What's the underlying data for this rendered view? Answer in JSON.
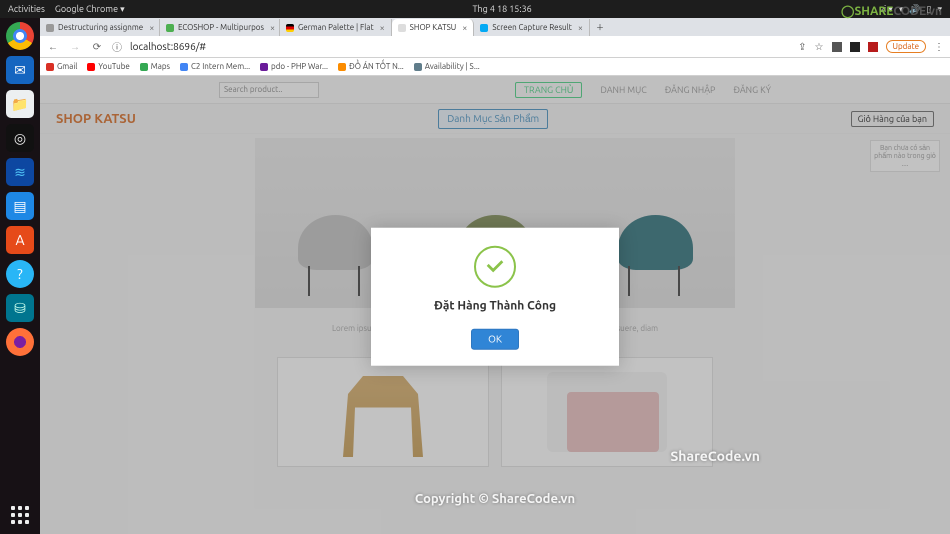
{
  "os": {
    "activities": "Activities",
    "app_name": "Google Chrome ▾",
    "clock": "Thg 4 18  15:36",
    "lang": "vi ▾",
    "tray_icons": [
      "network-icon",
      "volume-icon",
      "battery-icon",
      "power-icon"
    ]
  },
  "dock": [
    {
      "name": "chrome-icon"
    },
    {
      "name": "thunderbird-icon",
      "color": "#1565c0"
    },
    {
      "name": "files-icon",
      "color": "#f5f5f5"
    },
    {
      "name": "obs-icon",
      "color": "#222"
    },
    {
      "name": "vscode-icon",
      "color": "#0d47a1"
    },
    {
      "name": "libreoffice-icon",
      "color": "#1e88e5"
    },
    {
      "name": "software-icon",
      "color": "#e64a19"
    },
    {
      "name": "help-icon",
      "color": "#29b6f6"
    },
    {
      "name": "mysql-icon",
      "color": "#00758f"
    },
    {
      "name": "firefox-icon",
      "color": "#ff7139"
    }
  ],
  "browser": {
    "tabs": [
      {
        "label": "Destructuring assignme",
        "fav": "#999"
      },
      {
        "label": "ECOSHOP - Multipurpos",
        "fav": "#4caf50"
      },
      {
        "label": "German Palette | Flat ",
        "fav": "#000"
      },
      {
        "label": "SHOP KATSU",
        "fav": "#ddd",
        "active": true
      },
      {
        "label": "Screen Capture Result",
        "fav": "#03a9f4"
      }
    ],
    "nav": {
      "back": "←",
      "forward": "→",
      "reload": "⟳"
    },
    "url": "localhost:8696/#",
    "actions": {
      "share": "⇪",
      "star": "☆",
      "ext1": "■",
      "ext2": "■",
      "ext3": "■",
      "update": "Update"
    },
    "bookmarks": [
      {
        "fav": "#d93025",
        "label": "Gmail"
      },
      {
        "fav": "#ff0000",
        "label": "YouTube"
      },
      {
        "fav": "#34a853",
        "label": "Maps"
      },
      {
        "fav": "#4285f4",
        "label": "C2 Intern Mem..."
      },
      {
        "fav": "#6a1b9a",
        "label": "pdo - PHP War..."
      },
      {
        "fav": "#fb8c00",
        "label": "ĐỒ ÁN TỐT N..."
      },
      {
        "fav": "#607d8b",
        "label": "Availability | S..."
      }
    ]
  },
  "site": {
    "search_placeholder": "Search product..",
    "nav": {
      "home": "TRANG CHỦ",
      "category": "DANH MỤC",
      "login": "ĐĂNG NHẬP",
      "register": "ĐĂNG KÝ"
    },
    "brand": "SHOP KATSU",
    "cat_button": "Danh Mục Sản Phẩm",
    "cart_button": "Giỏ Hàng của bạn",
    "cart_empty": "Bạn chưa có sản phẩm nào trong giỏ ....",
    "lorem": "Lorem ipsum dolor sit a.................................................................................tristique posuere, diam"
  },
  "modal": {
    "title": "Đặt Hàng Thành Công",
    "ok": "OK"
  },
  "watermark": {
    "brand": "ShareCode.vn",
    "copy": "Copyright © ShareCode.vn",
    "logo_a": "SHARE",
    "logo_b": "CODE.vn"
  }
}
